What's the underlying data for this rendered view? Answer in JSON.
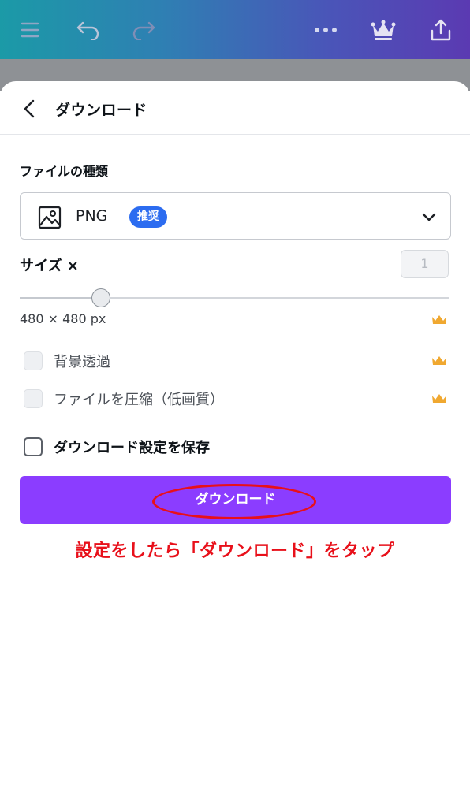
{
  "topbar": {
    "icons": [
      "menu-icon",
      "undo-icon",
      "redo-icon",
      "more-icon",
      "crown-icon",
      "share-upload-icon"
    ]
  },
  "panel": {
    "title": "ダウンロード",
    "file_type": {
      "label": "ファイルの種類",
      "value": "PNG",
      "badge": "推奨"
    },
    "size": {
      "label": "サイズ ×",
      "input_placeholder": "1",
      "slider_fraction": 0.19,
      "dimensions": "480 × 480 px"
    },
    "options": [
      {
        "label": "背景透過",
        "checked": false,
        "premium": true
      },
      {
        "label": "ファイルを圧縮（低画質）",
        "checked": false,
        "premium": true
      }
    ],
    "save_settings": {
      "label": "ダウンロード設定を保存",
      "checked": false
    },
    "download_button": "ダウンロード"
  },
  "annotation": {
    "instruction": "設定をしたら「ダウンロード」をタップ"
  },
  "colors": {
    "accent": "#8b3dff",
    "badge": "#2c6cf0",
    "annotation": "#e8101a",
    "crown": "#f0a830"
  }
}
